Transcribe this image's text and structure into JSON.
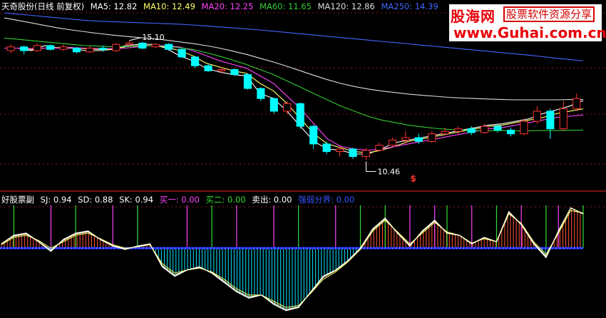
{
  "main_panel": {
    "stock_label": "天奇股份(日线 前复权)",
    "indicators": [
      {
        "label": "MA5: 12.82",
        "color": "#ffffff"
      },
      {
        "label": "MA10: 12.49",
        "color": "#ffff66"
      },
      {
        "label": "MA20: 12.25",
        "color": "#ff44ff"
      },
      {
        "label": "MA60: 11.65",
        "color": "#33cc33"
      },
      {
        "label": "MA120: 12.86",
        "color": "#dddddd"
      },
      {
        "label": "MA250: 14.39",
        "color": "#4466ff"
      }
    ]
  },
  "indicator_panel": {
    "title": "好股票副",
    "values": [
      {
        "label": "SJ: 0.94",
        "color": "#ffffff"
      },
      {
        "label": "SD: 0.88",
        "color": "#ffffff"
      },
      {
        "label": "SK: 0.94",
        "color": "#ffffff"
      },
      {
        "label": "买一: 0.00",
        "color": "#ff44ff"
      },
      {
        "label": "买二: 0.00",
        "color": "#33dd33"
      },
      {
        "label": "卖出: 0.00",
        "color": "#ffffff"
      },
      {
        "label": "强弱分界: 0.00",
        "color": "#3355ff"
      }
    ]
  },
  "watermark": {
    "name": "股海网",
    "slogan": "股票软件资源分享",
    "url": "www.Guhai.com.cn"
  },
  "colors": {
    "up_candle": "#ff3333",
    "down_candle": "#00ffff",
    "grid": "#8b1a1a",
    "bull_bar": "#ff5533",
    "bear_bar": "#00e5ff",
    "buy1_line": "#ff44ff",
    "buy2_line": "#33dd33",
    "baseline": "#2233ff"
  },
  "chart_data": [
    {
      "type": "line",
      "title": "天奇股份(日线 前复权)",
      "annotations": [
        {
          "text": "15.10",
          "kind": "high"
        },
        {
          "text": "10.46",
          "kind": "low"
        },
        {
          "text": "$",
          "kind": "marker"
        }
      ],
      "y_range": [
        9.4,
        16.3
      ],
      "series": [
        {
          "name": "MA5",
          "color": "#ffffff",
          "values": [
            14.9,
            14.9,
            14.8,
            15.0,
            14.9,
            14.9,
            14.8,
            14.8,
            14.85,
            15.0,
            15.05,
            15.05,
            14.9,
            14.6,
            14.4,
            14.1,
            13.95,
            13.85,
            13.8,
            13.1,
            12.9,
            12.4,
            11.8,
            11.2,
            10.9,
            10.85,
            10.7,
            10.7,
            10.9,
            11.15,
            11.25,
            11.35,
            11.45,
            11.55,
            11.65,
            11.75,
            11.85,
            11.9,
            12.0,
            12.1,
            12.3,
            12.45,
            12.6,
            12.82
          ]
        },
        {
          "name": "MA10",
          "color": "#ffff66",
          "values": [
            14.9,
            14.9,
            14.85,
            14.9,
            14.92,
            14.92,
            14.88,
            14.85,
            14.85,
            14.95,
            15.0,
            15.0,
            14.95,
            14.8,
            14.6,
            14.3,
            14.15,
            14.0,
            13.9,
            13.5,
            13.2,
            12.7,
            12.1,
            11.5,
            11.1,
            10.95,
            10.8,
            10.75,
            10.85,
            11.0,
            11.2,
            11.3,
            11.4,
            11.5,
            11.6,
            11.7,
            11.8,
            11.85,
            11.95,
            12.05,
            12.15,
            12.3,
            12.4,
            12.49
          ]
        },
        {
          "name": "MA20",
          "color": "#ff44ff",
          "values": [
            14.9,
            14.9,
            14.88,
            14.9,
            14.9,
            14.92,
            14.9,
            14.88,
            14.88,
            14.9,
            14.95,
            15.0,
            15.0,
            14.95,
            14.8,
            14.6,
            14.4,
            14.25,
            14.1,
            13.8,
            13.5,
            13.0,
            12.5,
            11.9,
            11.3,
            11.0,
            10.9,
            10.85,
            10.9,
            11.0,
            11.1,
            11.2,
            11.3,
            11.4,
            11.5,
            11.6,
            11.7,
            11.75,
            11.85,
            11.95,
            12.05,
            12.15,
            12.2,
            12.25
          ]
        },
        {
          "name": "MA60",
          "color": "#33cc33",
          "values": [
            15.3,
            15.25,
            15.2,
            15.15,
            15.1,
            15.05,
            15.0,
            14.98,
            14.96,
            14.96,
            14.98,
            15.0,
            14.97,
            14.92,
            14.85,
            14.72,
            14.58,
            14.42,
            14.25,
            14.05,
            13.85,
            13.6,
            13.35,
            13.1,
            12.85,
            12.6,
            12.4,
            12.2,
            12.05,
            11.95,
            11.85,
            11.78,
            11.72,
            11.68,
            11.65,
            11.63,
            11.62,
            11.63,
            11.62,
            11.62,
            11.63,
            11.63,
            11.64,
            11.65
          ]
        },
        {
          "name": "MA120",
          "color": "#dddddd",
          "values": [
            16.1,
            16.0,
            15.9,
            15.8,
            15.7,
            15.62,
            15.55,
            15.48,
            15.42,
            15.37,
            15.32,
            15.28,
            15.22,
            15.15,
            15.08,
            15.0,
            14.9,
            14.78,
            14.65,
            14.5,
            14.35,
            14.18,
            14.0,
            13.82,
            13.65,
            13.5,
            13.38,
            13.28,
            13.2,
            13.14,
            13.08,
            13.03,
            12.99,
            12.95,
            12.92,
            12.9,
            12.88,
            12.86,
            12.85,
            12.85,
            12.85,
            12.85,
            12.86,
            12.86
          ]
        },
        {
          "name": "MA250",
          "color": "#4466ff",
          "values": [
            16.3,
            16.25,
            16.2,
            16.15,
            16.1,
            16.05,
            16.0,
            15.97,
            15.95,
            15.93,
            15.91,
            15.89,
            15.87,
            15.85,
            15.82,
            15.78,
            15.74,
            15.7,
            15.66,
            15.62,
            15.57,
            15.52,
            15.47,
            15.42,
            15.37,
            15.32,
            15.27,
            15.22,
            15.17,
            15.12,
            15.07,
            15.02,
            14.97,
            14.92,
            14.87,
            14.82,
            14.77,
            14.72,
            14.67,
            14.62,
            14.56,
            14.5,
            14.45,
            14.39
          ]
        }
      ],
      "candles": [
        [
          14.8,
          14.95,
          15.05,
          14.7
        ],
        [
          14.95,
          14.8,
          15.0,
          14.65
        ],
        [
          14.8,
          15.0,
          15.1,
          14.75
        ],
        [
          15.0,
          14.85,
          15.05,
          14.8
        ],
        [
          14.85,
          14.95,
          15.05,
          14.8
        ],
        [
          14.9,
          14.75,
          14.95,
          14.7
        ],
        [
          14.75,
          14.9,
          15.0,
          14.7
        ],
        [
          14.9,
          14.85,
          15.0,
          14.75
        ],
        [
          14.8,
          15.05,
          15.1,
          14.75
        ],
        [
          15.05,
          15.1,
          15.2,
          15.0
        ],
        [
          15.1,
          14.9,
          15.15,
          14.85
        ],
        [
          14.95,
          15.05,
          15.1,
          14.9
        ],
        [
          15.05,
          14.85,
          15.1,
          14.8
        ],
        [
          14.85,
          14.55,
          14.9,
          14.5
        ],
        [
          14.55,
          14.2,
          14.6,
          14.1
        ],
        [
          14.2,
          14.0,
          14.3,
          13.95
        ],
        [
          14.0,
          14.05,
          14.15,
          13.9
        ],
        [
          14.05,
          13.85,
          14.1,
          13.8
        ],
        [
          13.85,
          13.3,
          13.9,
          13.25
        ],
        [
          13.3,
          12.9,
          13.35,
          12.8
        ],
        [
          12.9,
          12.4,
          12.95,
          12.3
        ],
        [
          12.4,
          12.7,
          12.8,
          12.3
        ],
        [
          12.7,
          11.8,
          12.75,
          11.7
        ],
        [
          11.8,
          11.1,
          11.85,
          10.9
        ],
        [
          11.1,
          10.8,
          11.2,
          10.7
        ],
        [
          10.8,
          10.9,
          11.0,
          10.6
        ],
        [
          10.9,
          10.6,
          10.95,
          10.5
        ],
        [
          10.6,
          10.85,
          10.95,
          10.46
        ],
        [
          10.85,
          11.05,
          11.15,
          10.8
        ],
        [
          11.05,
          11.25,
          11.35,
          11.0
        ],
        [
          11.25,
          11.35,
          11.6,
          11.1
        ],
        [
          11.35,
          11.2,
          11.5,
          11.1
        ],
        [
          11.2,
          11.5,
          11.6,
          11.15
        ],
        [
          11.5,
          11.6,
          11.75,
          11.45
        ],
        [
          11.6,
          11.7,
          11.8,
          11.5
        ],
        [
          11.7,
          11.55,
          11.8,
          11.45
        ],
        [
          11.55,
          11.8,
          11.9,
          11.5
        ],
        [
          11.8,
          11.65,
          11.9,
          11.55
        ],
        [
          11.65,
          11.5,
          11.75,
          11.4
        ],
        [
          11.5,
          12.0,
          12.1,
          11.45
        ],
        [
          12.0,
          12.4,
          12.6,
          11.9
        ],
        [
          12.4,
          11.7,
          12.5,
          11.3
        ],
        [
          11.7,
          12.5,
          12.8,
          11.6
        ],
        [
          12.5,
          12.9,
          13.1,
          12.4
        ]
      ]
    },
    {
      "type": "bar",
      "title": "好股票副",
      "baseline": 0,
      "y_range": [
        -1.05,
        1.0
      ],
      "series": [
        {
          "name": "SJ",
          "values": [
            0.1,
            0.3,
            0.35,
            0.15,
            -0.05,
            0.2,
            0.35,
            0.4,
            0.2,
            0.05,
            -0.02,
            0.05,
            0.1,
            -0.3,
            -0.45,
            -0.35,
            -0.3,
            -0.4,
            -0.55,
            -0.7,
            -0.8,
            -0.75,
            -0.9,
            -1.0,
            -0.95,
            -0.7,
            -0.45,
            -0.35,
            -0.2,
            0.0,
            0.45,
            0.7,
            0.35,
            0.05,
            0.4,
            0.65,
            0.35,
            0.3,
            0.1,
            0.25,
            0.15,
            0.85,
            0.55,
            0.1,
            -0.15,
            0.4,
            0.94,
            0.8
          ]
        },
        {
          "name": "SD",
          "values": [
            0.08,
            0.25,
            0.3,
            0.18,
            0.0,
            0.15,
            0.3,
            0.35,
            0.22,
            0.08,
            0.0,
            0.03,
            0.08,
            -0.25,
            -0.4,
            -0.35,
            -0.32,
            -0.38,
            -0.5,
            -0.65,
            -0.75,
            -0.75,
            -0.85,
            -0.95,
            -0.92,
            -0.72,
            -0.5,
            -0.38,
            -0.22,
            -0.02,
            0.4,
            0.65,
            0.38,
            0.1,
            0.35,
            0.6,
            0.38,
            0.3,
            0.12,
            0.22,
            0.15,
            0.8,
            0.58,
            0.15,
            -0.1,
            0.35,
            0.88,
            0.82
          ]
        },
        {
          "name": "SK",
          "values": [
            0.1,
            0.28,
            0.33,
            0.16,
            -0.03,
            0.18,
            0.33,
            0.38,
            0.21,
            0.06,
            -0.01,
            0.04,
            0.09,
            -0.28,
            -0.43,
            -0.35,
            -0.31,
            -0.39,
            -0.53,
            -0.68,
            -0.78,
            -0.75,
            -0.88,
            -0.98,
            -0.94,
            -0.71,
            -0.47,
            -0.36,
            -0.21,
            -0.01,
            0.43,
            0.68,
            0.36,
            0.07,
            0.38,
            0.63,
            0.36,
            0.3,
            0.11,
            0.24,
            0.15,
            0.83,
            0.56,
            0.12,
            -0.13,
            0.38,
            0.94,
            0.81
          ]
        }
      ],
      "signals": {
        "买一": [
          4,
          9,
          15,
          19,
          22,
          27,
          33,
          35,
          38,
          42,
          45
        ],
        "买二": [
          1,
          6,
          11,
          17,
          24,
          29,
          31,
          36,
          40,
          44,
          47
        ]
      }
    }
  ]
}
